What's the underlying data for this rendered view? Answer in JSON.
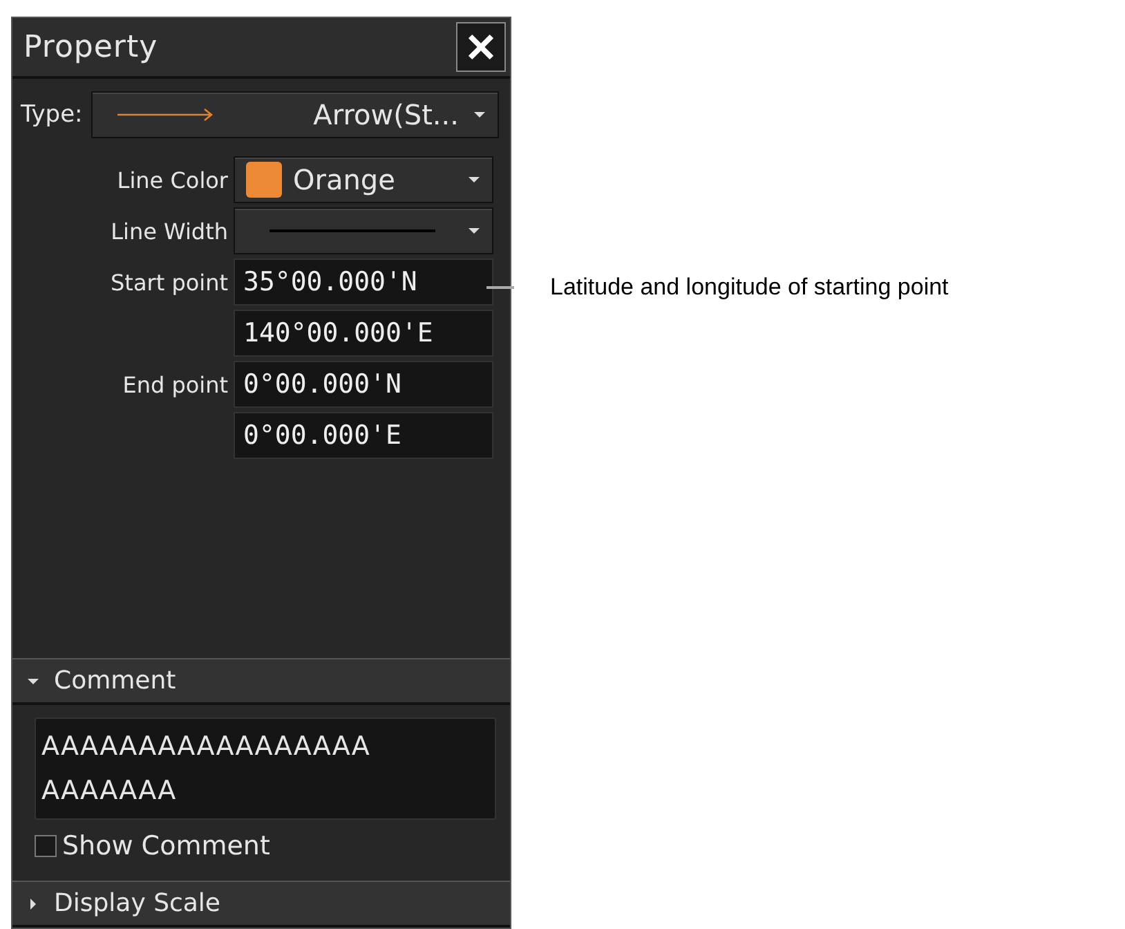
{
  "window": {
    "title": "Property"
  },
  "type_select": {
    "label": "Type:",
    "value": "Arrow(St..."
  },
  "line_color": {
    "label": "Line Color",
    "value": "Orange",
    "color": "#ec8a35"
  },
  "line_width": {
    "label": "Line Width"
  },
  "points": [
    {
      "label": "Start point",
      "values": [
        "35°00.000'N",
        "140°00.000'E"
      ]
    },
    {
      "label": "End point",
      "values": [
        "0°00.000'N",
        "0°00.000'E"
      ]
    }
  ],
  "sections": [
    {
      "title": "Comment",
      "expanded": true,
      "comment": [
        "AAAAAAAAAAAAAAAAA",
        "AAAAAAA"
      ],
      "checkbox": {
        "label": "Show Comment",
        "checked": false
      }
    },
    {
      "title": "Display Scale",
      "expanded": false
    }
  ],
  "annotation": "Latitude and longitude of starting point"
}
